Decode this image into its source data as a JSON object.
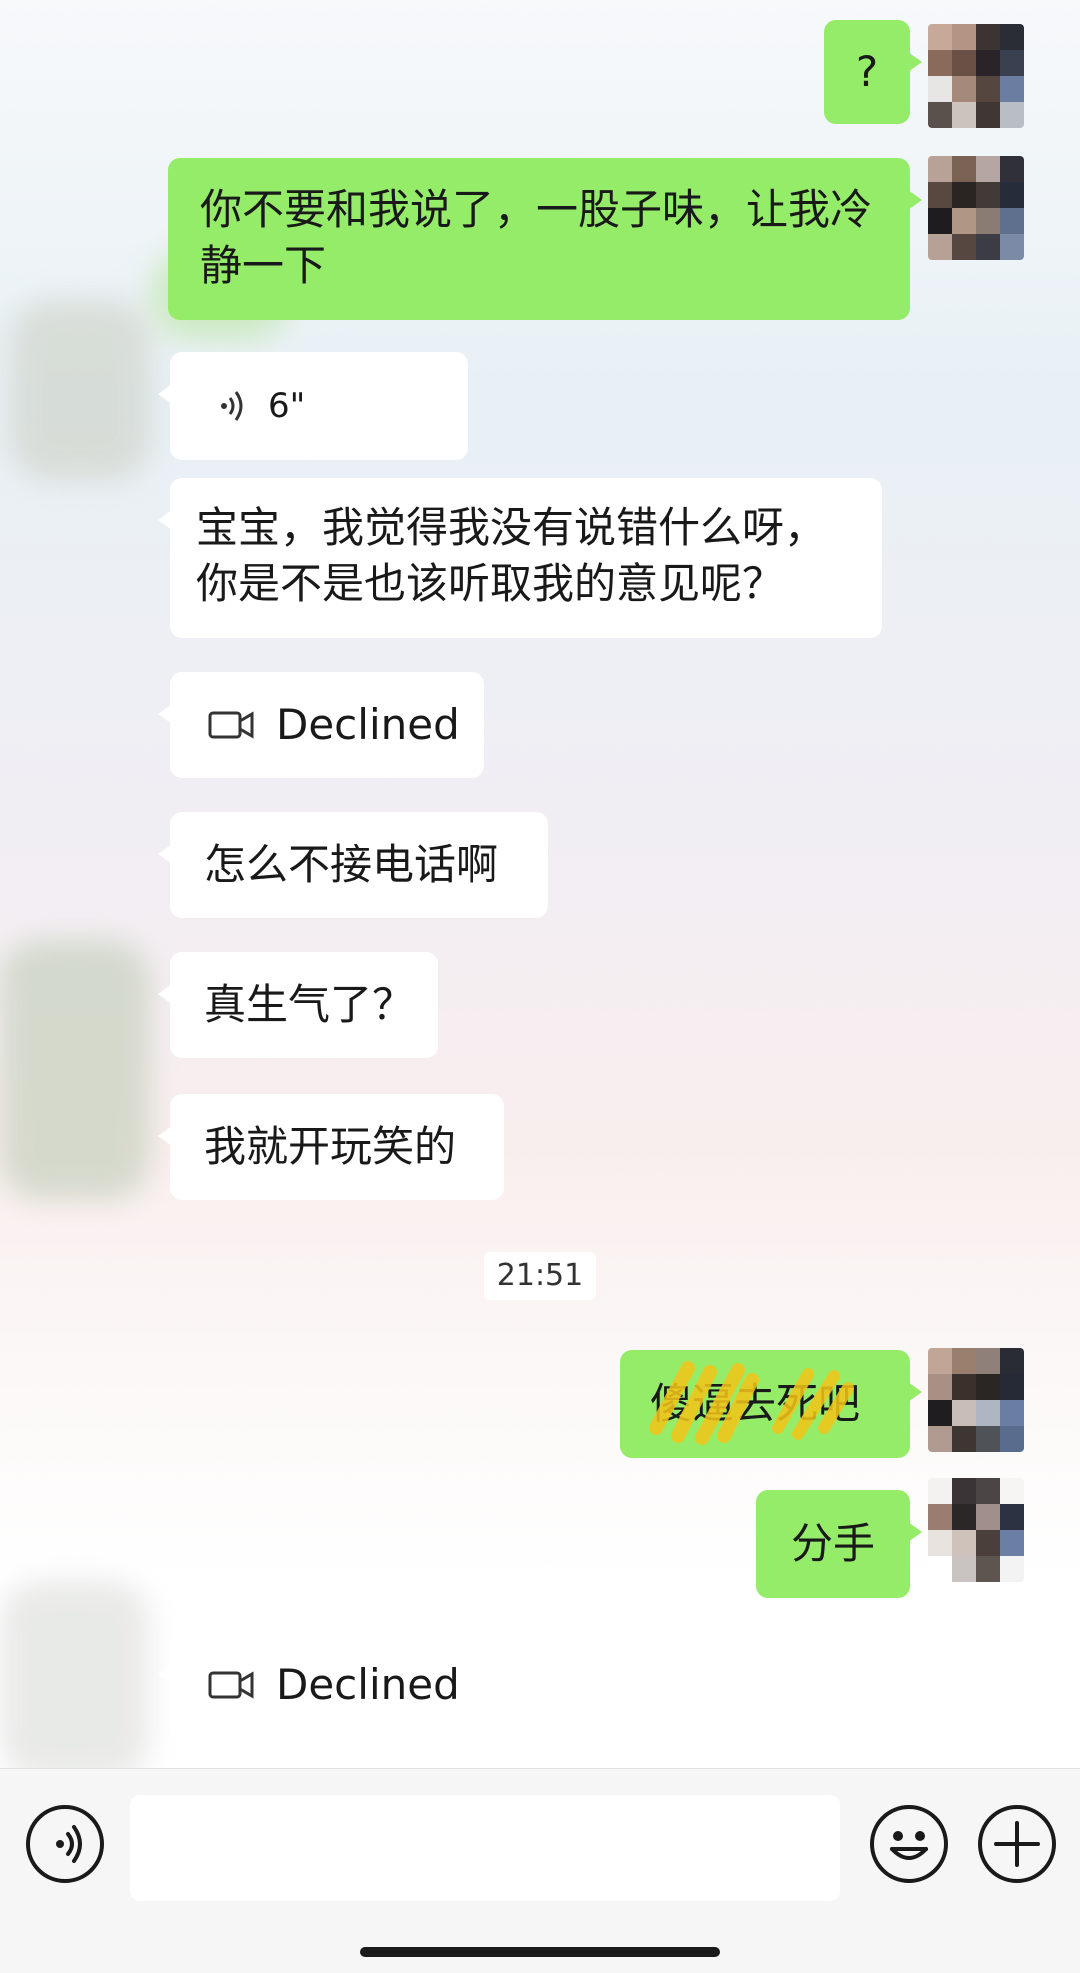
{
  "messages": {
    "m1": {
      "text": "?"
    },
    "m2": {
      "text": "你不要和我说了，一股子味，让我冷静一下"
    },
    "m3": {
      "duration": "6\""
    },
    "m4": {
      "text": "宝宝，我觉得我没有说错什么呀，你是不是也该听取我的意见呢？"
    },
    "m5": {
      "text": "Declined"
    },
    "m6": {
      "text": "怎么不接电话啊"
    },
    "m7": {
      "text": "真生气了？"
    },
    "m8": {
      "text": "我就开玩笑的"
    },
    "m9": {
      "text": "傻逼去死吧"
    },
    "m10": {
      "text": "分手"
    },
    "m11": {
      "text": "Declined"
    }
  },
  "timestamp": "21:51",
  "icons": {
    "voice_message": "voice-wave-icon",
    "video_call": "video-camera-icon",
    "voice_input": "voice-input-icon",
    "emoji": "emoji-icon",
    "more": "plus-icon"
  },
  "colors": {
    "outgoing_bubble": "#95ec69",
    "incoming_bubble": "#ffffff"
  }
}
